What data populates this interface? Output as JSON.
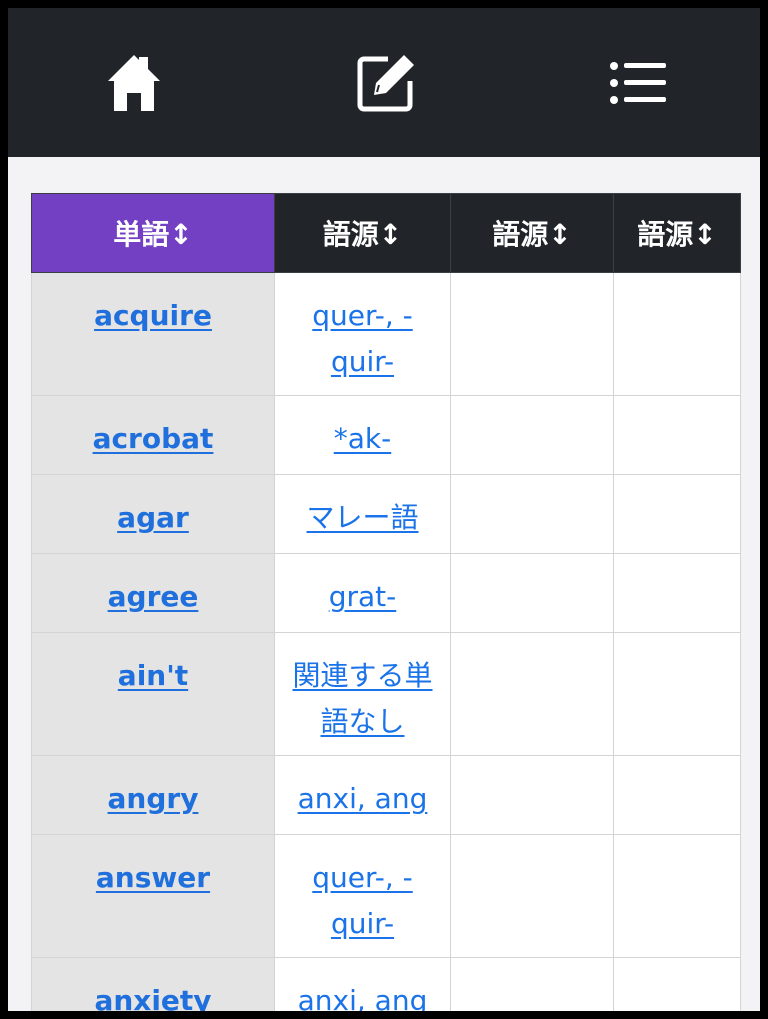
{
  "nav": {
    "home_icon": "home-icon",
    "edit_icon": "edit-icon",
    "menu_icon": "list-icon"
  },
  "table": {
    "headers": [
      "単語↕",
      "語源↕",
      "語源↕",
      "語源↕"
    ],
    "rows": [
      {
        "word": "acquire",
        "roots": [
          "quer-, -quir-",
          "",
          ""
        ]
      },
      {
        "word": "acrobat",
        "roots": [
          "*ak-",
          "",
          ""
        ]
      },
      {
        "word": "agar",
        "roots": [
          "マレー語",
          "",
          ""
        ]
      },
      {
        "word": "agree",
        "roots": [
          "grat-",
          "",
          ""
        ]
      },
      {
        "word": "ain't",
        "roots": [
          "関連する単語なし",
          "",
          ""
        ]
      },
      {
        "word": "angry",
        "roots": [
          "anxi, ang",
          "",
          ""
        ]
      },
      {
        "word": "answer",
        "roots": [
          "quer-, -quir-",
          "",
          ""
        ]
      },
      {
        "word": "anxiety",
        "roots": [
          "anxi, ang",
          "",
          ""
        ]
      }
    ]
  },
  "colors": {
    "topbar": "#212529",
    "sorted_header": "#7340c3",
    "link": "#1a73e8"
  }
}
